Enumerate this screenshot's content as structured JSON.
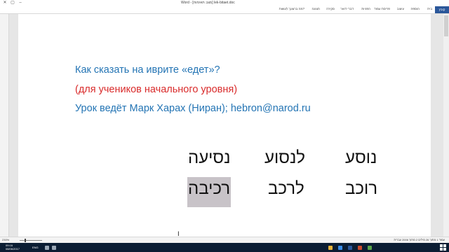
{
  "window": {
    "title": "Word - [מצב תאימות] lek-bitaet.doc"
  },
  "ribbon": {
    "tabs": [
      "קובץ",
      "בית",
      "הוספה",
      "עיצוב",
      "פריסת עמוד",
      "הפניות",
      "דברי דואר",
      "סקירה",
      "תצוגה",
      "מה ברצונך לעשות?"
    ]
  },
  "status": {
    "zoom": "230%",
    "right_text": "עמוד 1 מתוך 26   מילים 2 מתוך 2006   עברית"
  },
  "taskbar": {
    "clock": "09:16\n08/06/2017",
    "lang": "ENG"
  },
  "document": {
    "line1": "Как сказать на иврите «едет»?",
    "line2": "(для учеников начального уровня)",
    "line3": "Урок ведёт Марк Харах (Ниран); hebron@narod.ru",
    "row1": [
      "נוסע",
      "לנסוע",
      "נסיעה"
    ],
    "row2": [
      "רוכב",
      "לרכב",
      "רכיבה"
    ]
  },
  "colors": {
    "blue_text": "#2374b4",
    "red_text": "#d92b2b",
    "highlight": "#c8c3c8",
    "taskbar": "#0b1d33",
    "file_tab": "#2b579a"
  },
  "icons": [
    "minimize-icon",
    "maximize-icon",
    "close-icon",
    "windows-start-icon",
    "mouse-cursor-icon"
  ]
}
